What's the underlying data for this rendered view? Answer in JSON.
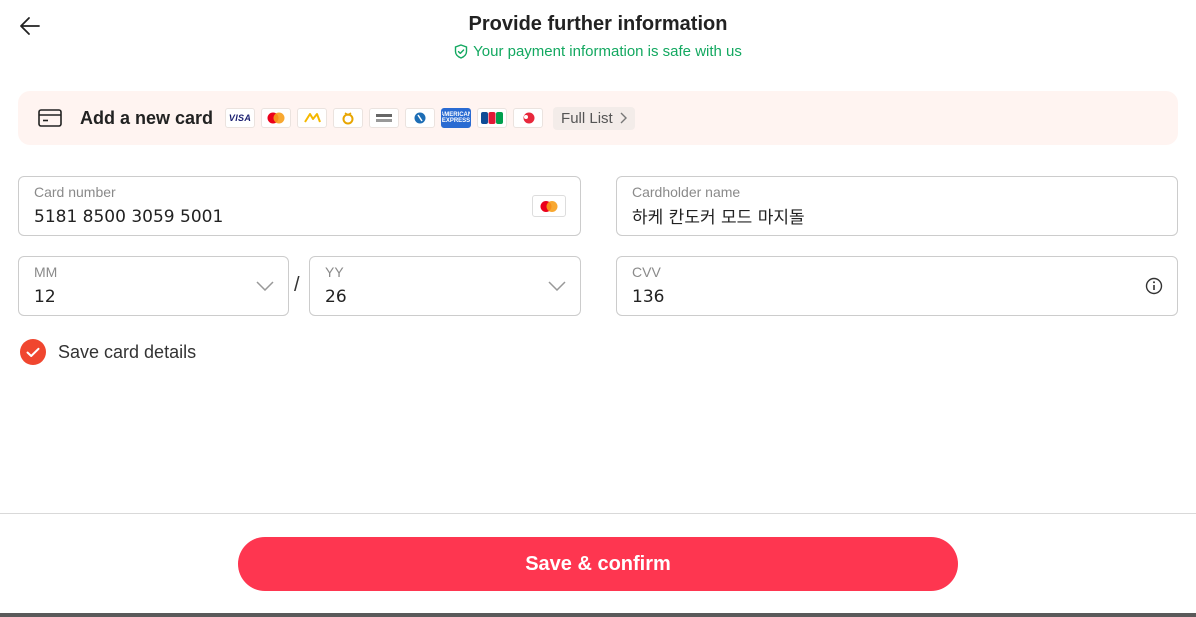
{
  "header": {
    "title": "Provide further information",
    "safe_note": "Your payment information is safe with us"
  },
  "banner": {
    "title": "Add a new card",
    "brands": [
      "visa-icon",
      "mastercard-icon",
      "kb-card-icon",
      "card-brand-4-icon",
      "card-brand-5-icon",
      "card-brand-6-icon",
      "amex-icon",
      "jcb-icon",
      "card-brand-9-icon"
    ],
    "full_list_label": "Full List"
  },
  "form": {
    "card_number": {
      "label": "Card number",
      "value": "5181 8500 3059 5001"
    },
    "cardholder": {
      "label": "Cardholder name",
      "value": "하케 칸도커 모드 마지돌"
    },
    "month": {
      "label": "MM",
      "value": "12"
    },
    "year": {
      "label": "YY",
      "value": "26"
    },
    "separator": "/",
    "cvv": {
      "label": "CVV",
      "value": "136"
    },
    "save_card": {
      "label": "Save card details",
      "checked": true
    }
  },
  "footer": {
    "confirm_label": "Save & confirm"
  },
  "colors": {
    "accent": "#fe3650",
    "checkbox": "#f0462f",
    "safe_green": "#13a860",
    "banner_bg": "#fff4f1"
  }
}
